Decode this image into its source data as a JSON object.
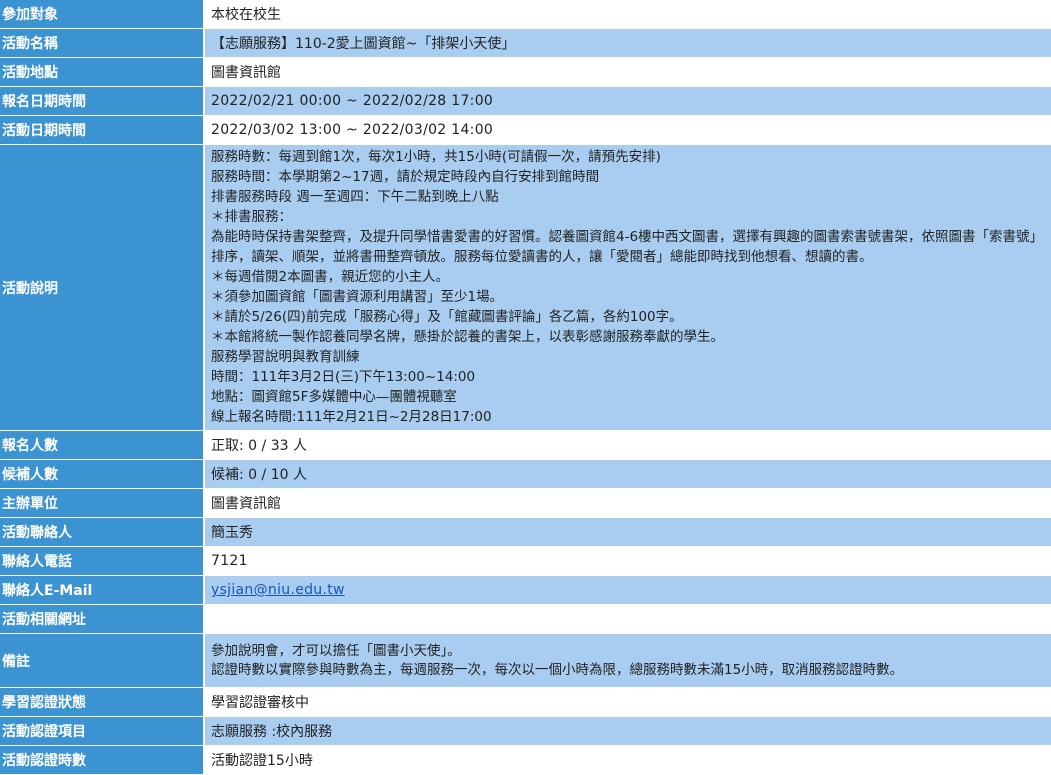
{
  "rows": {
    "target": {
      "label": "參加對象",
      "value": "本校在校生"
    },
    "name": {
      "label": "活動名稱",
      "value": "【志願服務】110-2愛上圖資館~「排架小天使」"
    },
    "place": {
      "label": "活動地點",
      "value": "圖書資訊館"
    },
    "signup_time": {
      "label": "報名日期時間",
      "value": "2022/02/21 00:00 ~ 2022/02/28 17:00"
    },
    "event_time": {
      "label": "活動日期時間",
      "value": "2022/03/02 13:00 ~ 2022/03/02 14:00"
    },
    "description": {
      "label": "活動說明",
      "lines": [
        "服務時數：每週到館1次，每次1小時，共15小時(可請假一次，請預先安排)",
        "服務時間：本學期第2~17週，請於規定時段內自行安排到館時間",
        "排書服務時段 週一至週四：下午二點到晚上八點",
        " ＊排書服務：",
        "為能時時保持書架整齊，及提升同學惜書愛書的好習慣。認養圖資館4-6樓中西文圖書，選擇有興趣的圖書索書號書架，依照圖書「索書號」排序，讀架、順架，並將書冊整齊頓放。服務每位愛讀書的人，讓「愛閱者」總能即時找到他想看、想讀的書。",
        " ＊每週借閱2本圖書，親近您的小主人。",
        " ＊須參加圖資館「圖書資源利用講習」至少1場。",
        " ＊請於5/26(四)前完成「服務心得」及「館藏圖書評論」各乙篇，各約100字。",
        " ＊本館將統一製作認養同學名牌，懸掛於認養的書架上，以表彰感謝服務奉獻的學生。",
        "服務學習說明與教育訓練",
        "時間：111年3月2日(三)下午13:00~14:00",
        "地點：圖資館5F多媒體中心—團體視聽室",
        "線上報名時間:111年2月21日~2月28日17:00"
      ]
    },
    "enrolled": {
      "label": "報名人數",
      "value": "正取: 0 / 33 人"
    },
    "waitlist": {
      "label": "候補人數",
      "value": "候補: 0 / 10 人"
    },
    "organizer": {
      "label": "主辦單位",
      "value": "圖書資訊館"
    },
    "contact": {
      "label": "活動聯絡人",
      "value": "簡玉秀"
    },
    "phone": {
      "label": "聯絡人電話",
      "value": "7121"
    },
    "email": {
      "label": "聯絡人E-Mail",
      "value": "ysjian@niu.edu.tw"
    },
    "url": {
      "label": "活動相關網址",
      "value": ""
    },
    "remarks": {
      "label": "備註",
      "lines": [
        "參加說明會，才可以擔任「圖書小天使」。",
        "認證時數以實際參與時數為主，每週服務一次，每次以一個小時為限，總服務時數未滿15小時，取消服務認證時數。"
      ]
    },
    "status": {
      "label": "學習認證狀態",
      "value": "學習認證審核中"
    },
    "cert_item": {
      "label": "活動認證項目",
      "value": "志願服務 :校內服務"
    },
    "cert_hours": {
      "label": "活動認證時數",
      "value": "活動認證15小時"
    }
  },
  "colors": {
    "label_bg": "#3b93d2",
    "row_alt_bg": "#a8cdf0",
    "row_bg": "#ffffff",
    "link": "#1a56b8"
  }
}
